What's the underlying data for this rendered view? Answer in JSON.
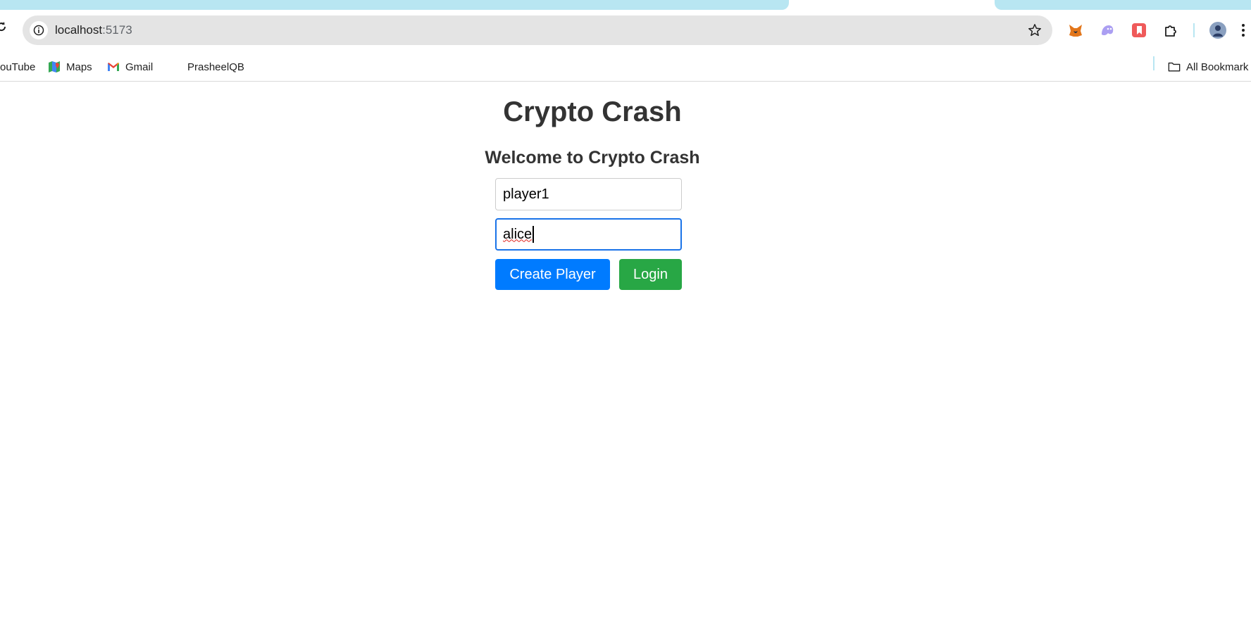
{
  "browser": {
    "url_host": "localhost",
    "url_port": ":5173",
    "bookmarks": [
      {
        "label": "ouTube",
        "icon": "youtube-icon"
      },
      {
        "label": "Maps",
        "icon": "maps-icon"
      },
      {
        "label": "Gmail",
        "icon": "gmail-icon"
      },
      {
        "label": "PrasheelQB",
        "icon": "bookmark-icon"
      }
    ],
    "all_bookmarks_label": "All Bookmark",
    "extensions": [
      "metamask-icon",
      "ghost-extension-icon",
      "red-bookmark-extension-icon",
      "puzzle-extensions-icon",
      "profile-avatar-icon",
      "more-menu-icon"
    ],
    "colors": {
      "tab_accent": "#b8e6f2",
      "omnibox_bg": "#e4e4e4"
    }
  },
  "page": {
    "title": "Crypto Crash",
    "subtitle": "Welcome to Crypto Crash",
    "player_id_value": "player1",
    "username_value": "alice",
    "create_button_label": "Create Player",
    "login_button_label": "Login",
    "colors": {
      "create": "#007bff",
      "login": "#28a745",
      "heading": "#333333"
    }
  }
}
